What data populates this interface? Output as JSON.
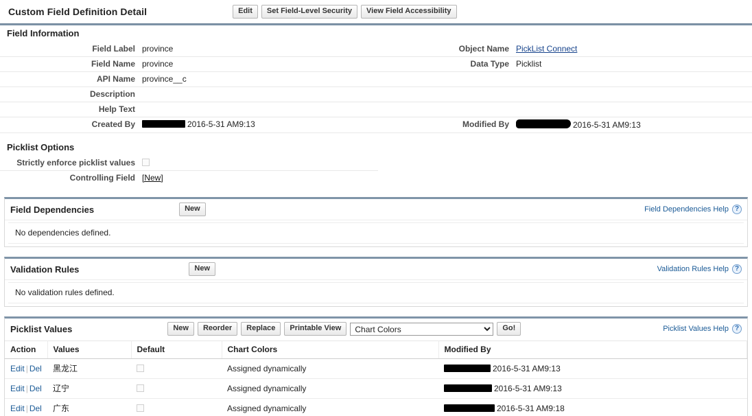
{
  "page": {
    "title": "Custom Field Definition Detail",
    "buttons": [
      {
        "label": "Edit",
        "name": "edit-button"
      },
      {
        "label": "Set Field-Level Security",
        "name": "set-field-level-security-button"
      },
      {
        "label": "View Field Accessibility",
        "name": "view-field-accessibility-button"
      }
    ]
  },
  "field_information": {
    "heading": "Field Information",
    "rows": [
      {
        "label": "Field Label",
        "value": "province",
        "label_right": "Object Name",
        "value_right": "PickList Connect",
        "right_is_link": true
      },
      {
        "label": "Field Name",
        "value": "province",
        "label_right": "Data Type",
        "value_right": "Picklist",
        "right_is_link": false
      },
      {
        "label": "API Name",
        "value": "province__c",
        "label_right": "",
        "value_right": "",
        "right_is_link": false
      },
      {
        "label": "Description",
        "value": "",
        "label_right": "",
        "value_right": "",
        "right_is_link": false
      },
      {
        "label": "Help Text",
        "value": "",
        "label_right": "",
        "value_right": "",
        "right_is_link": false
      },
      {
        "label": "Created By",
        "value": "2016-5-31 AM9:13",
        "label_right": "Modified By",
        "value_right": "2016-5-31 AM9:13",
        "right_is_link": false
      }
    ]
  },
  "picklist_options": {
    "heading": "Picklist Options",
    "strictly_enforce_label": "Strictly enforce picklist values",
    "strictly_enforce_checked": false,
    "controlling_field_label": "Controlling Field",
    "controlling_field_value": "[New]"
  },
  "field_dependencies": {
    "title": "Field Dependencies",
    "new_button": "New",
    "help_link": "Field Dependencies Help",
    "help_icon": "help-question-icon",
    "empty_message": "No dependencies defined."
  },
  "validation_rules": {
    "title": "Validation Rules",
    "new_button": "New",
    "help_link": "Validation Rules Help",
    "help_icon": "help-question-icon",
    "empty_message": "No validation rules defined."
  },
  "picklist_values": {
    "title": "Picklist Values",
    "buttons": [
      {
        "label": "New",
        "name": "picklist-new-button"
      },
      {
        "label": "Reorder",
        "name": "picklist-reorder-button"
      },
      {
        "label": "Replace",
        "name": "picklist-replace-button"
      },
      {
        "label": "Printable View",
        "name": "picklist-printable-view-button"
      }
    ],
    "select": {
      "selected": "Chart Colors",
      "options": [
        "Chart Colors"
      ]
    },
    "go_button": "Go!",
    "help_link": "Picklist Values Help",
    "help_icon": "help-question-icon",
    "columns": [
      "Action",
      "Values",
      "Default",
      "Chart Colors",
      "Modified By"
    ],
    "action_edit": "Edit",
    "action_separator": "|",
    "action_del": "Del",
    "rows": [
      {
        "value": "黑龙江",
        "default": false,
        "chart_colors": "Assigned dynamically",
        "modified_at": "2016-5-31 AM9:13"
      },
      {
        "value": "辽宁",
        "default": false,
        "chart_colors": "Assigned dynamically",
        "modified_at": "2016-5-31 AM9:13"
      },
      {
        "value": "广东",
        "default": false,
        "chart_colors": "Assigned dynamically",
        "modified_at": "2016-5-31 AM9:18"
      }
    ]
  },
  "colors": {
    "section_rule": "#7f94a8",
    "link": "#1a5a96",
    "row_separator": "#e8e8e8"
  }
}
